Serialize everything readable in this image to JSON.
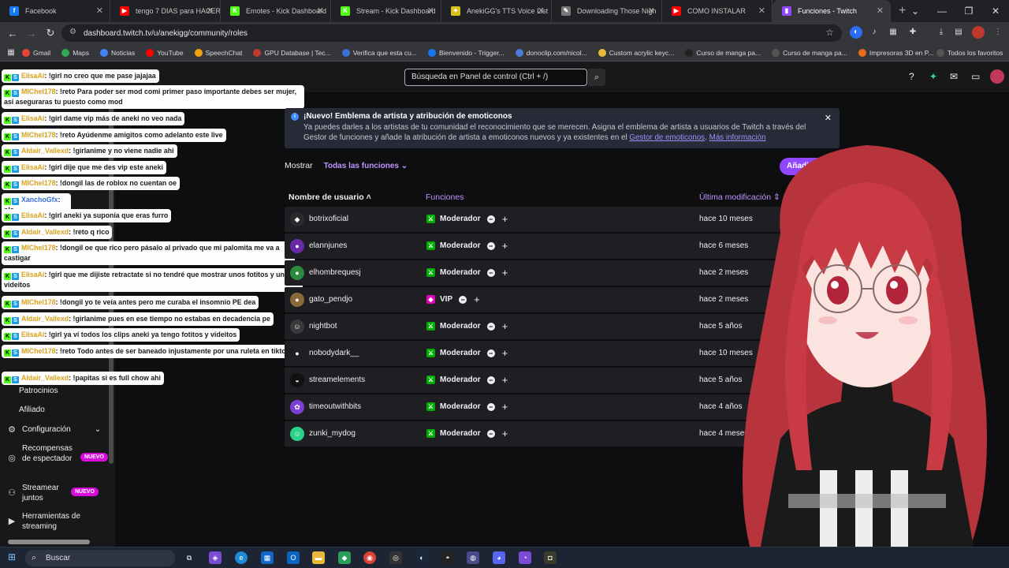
{
  "browser": {
    "tabs": [
      {
        "label": "Facebook",
        "icon": "f",
        "color": "#1877f2"
      },
      {
        "label": "tengo 7 DIAS para HACER",
        "icon": "▶",
        "color": "#ff0000"
      },
      {
        "label": "Emotes - Kick Dashboard",
        "icon": "K",
        "color": "#53fc18"
      },
      {
        "label": "Stream - Kick Dashboard",
        "icon": "K",
        "color": "#53fc18"
      },
      {
        "label": "AnekiGG's TTS Voice List",
        "icon": "✦",
        "color": "#d8c21a"
      },
      {
        "label": "Downloading Those Nigh",
        "icon": "✎",
        "color": "#777777"
      },
      {
        "label": "COMO INSTALAR",
        "icon": "▶",
        "color": "#ff0000"
      },
      {
        "label": "Funciones - Twitch",
        "icon": "▮",
        "color": "#9147ff"
      }
    ],
    "url": "dashboard.twitch.tv/u/anekigg/community/roles",
    "bookmarks": [
      "Gmail",
      "Maps",
      "Noticias",
      "YouTube",
      "SpeechChat",
      "GPU Database | Tec...",
      "Verifica que esta cu...",
      "Bienvenido - Trigger...",
      "donoclip.com/nicol...",
      "Custom acrylic keyc...",
      "Curso de manga pa...",
      "Curso de manga pa...",
      "Impresoras 3D en P...",
      "Todos los favoritos"
    ]
  },
  "twitch": {
    "search_placeholder": "Búsqueda en Panel de control (Ctrl + /)",
    "sidebar": {
      "items": [
        {
          "label": "Patrocinios"
        },
        {
          "label": "Afiliado"
        },
        {
          "label": "Configuración"
        },
        {
          "label": "Recompensas de espectador",
          "badge": "NUEVO"
        },
        {
          "label": "Streamear juntos",
          "badge": "NUEVO"
        },
        {
          "label": "Herramientas de streaming"
        }
      ]
    },
    "notice": {
      "title": "¡Nuevo! Emblema de artista y atribución de emoticonos",
      "body": "Ya puedes darles a los artistas de tu comunidad el reconocimiento que se merecen. Asigna el emblema de artista a usuarios de Twitch a través del",
      "body2": "Gestor de funciones y añade la atribución de artista a emoticonos nuevos y ya existentes en el",
      "link1": "Gestor de emoticonos",
      "link2": "Más información"
    },
    "filter": {
      "label": "Mostrar",
      "selected": "Todas las funciones"
    },
    "add_button": "Añadir nuevo",
    "table": {
      "headers": {
        "user": "Nombre de usuario",
        "roles": "Funciones",
        "modified": "Última modificación"
      },
      "rows": [
        {
          "user": "botrixoficial",
          "role": "Moderador",
          "when": "hace 10 meses",
          "avatar_color": "#2b2b2e",
          "avatar": "◆"
        },
        {
          "user": "elannjunes",
          "role": "Moderador",
          "when": "hace 6 meses",
          "avatar_color": "#6a2aa8",
          "avatar": "●"
        },
        {
          "user": "elhombrequesj",
          "role": "Moderador",
          "when": "hace 2 meses",
          "avatar_color": "#2b8a3e",
          "avatar": "●"
        },
        {
          "user": "gato_pendjo",
          "role": "VIP",
          "when": "hace 2 meses",
          "avatar_color": "#8a6a3a",
          "avatar": "●"
        },
        {
          "user": "nightbot",
          "role": "Moderador",
          "when": "hace 5 años",
          "avatar_color": "#3a3a3d",
          "avatar": "☺"
        },
        {
          "user": "nobodydark__",
          "role": "Moderador",
          "when": "hace 10 meses",
          "avatar_color": "#1f1f23",
          "avatar": "●"
        },
        {
          "user": "streamelements",
          "role": "Moderador",
          "when": "hace 5 años",
          "avatar_color": "#111111",
          "avatar": "◒"
        },
        {
          "user": "timeoutwithbits",
          "role": "Moderador",
          "when": "hace 4 años",
          "avatar_color": "#7b3fd6",
          "avatar": "✿"
        },
        {
          "user": "zunki_mydog",
          "role": "Moderador",
          "when": "hace 4 meses",
          "avatar_color": "#2bd28a",
          "avatar": "☺"
        }
      ]
    }
  },
  "chat": [
    {
      "user": "ElisaAi",
      "text": ": !girl no creo que me pase jajajaa",
      "blue": false
    },
    {
      "user": "MIChel178",
      "text": ": !reto Para poder ser mod comi primer paso importante debes ser mujer, así aseguraras tu puesto como mod",
      "blue": false
    },
    {
      "user": "ElisaAi",
      "text": ": !girl dame vip más de aneki no veo nada",
      "blue": false
    },
    {
      "user": "MIChel178",
      "text": ": !reto Ayúdenme amigitos como adelanto este live",
      "blue": false
    },
    {
      "user": "Aldair_Vallexd",
      "text": ": !girlanime y no viene nadie ahi",
      "blue": false
    },
    {
      "user": "ElisaAi",
      "text": ": !girl dije que me des vip este aneki",
      "blue": false
    },
    {
      "user": "MIChel178",
      "text": ": !dongil las de roblox no cuentan oe",
      "blue": false
    },
    {
      "user": "XanchoGfx",
      "text": ": ola",
      "blue": true
    },
    {
      "user": "ElisaAi",
      "text": ": !girl aneki ya suponía que eras furro",
      "blue": false
    },
    {
      "user": "Aldair_Vallexd",
      "text": ": !reto q rico",
      "blue": false
    },
    {
      "user": "MIChel178",
      "text": ": !dongil oe que rico pero pásalo al privado que mi palomita me va a castigar",
      "blue": false
    },
    {
      "user": "ElisaAi",
      "text": ": !girl que me dijiste retractate si no tendré que mostrar unos fotitos y unos videitos",
      "blue": false
    },
    {
      "user": "MIChel178",
      "text": ": !dongil yo te veía antes pero me curaba el insomnio PE dea",
      "blue": false
    },
    {
      "user": "Aldair_Vallexd",
      "text": ": !girlanime pues en ese tiempo no estabas en decadencia pe",
      "blue": false
    },
    {
      "user": "ElisaAi",
      "text": ": !girl ya ví todos los clips aneki ya tengo fotitos y videitos",
      "blue": false
    },
    {
      "user": "MIChel178",
      "text": ": !reto Todo antes de ser baneado injustamente por una ruleta en tiktok",
      "blue": false
    },
    {
      "user": "Aldair_Vallexd",
      "text": ": !papitas si es full chow ahi",
      "blue": false
    }
  ],
  "taskbar": {
    "search": "Buscar"
  }
}
